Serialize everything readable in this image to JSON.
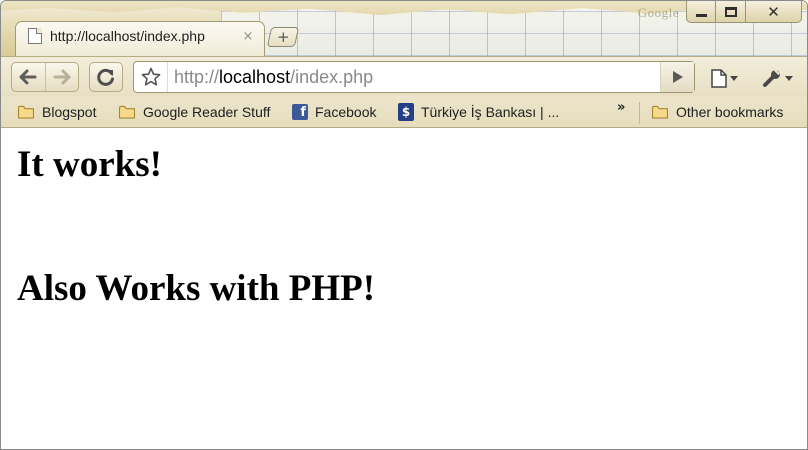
{
  "browser": {
    "tab": {
      "title": "http://localhost/index.php",
      "close_glyph": "×",
      "favicon": "page-icon"
    },
    "new_tab_glyph": "+",
    "window_controls": {
      "minimize": "minimize-icon",
      "maximize": "maximize-icon",
      "close": "close-icon",
      "close_glyph": "✕"
    },
    "toolbar": {
      "back": "back-arrow-icon",
      "forward": "forward-arrow-icon",
      "reload": "reload-icon",
      "star": "star-icon",
      "url_scheme": "http://",
      "url_host": "localhost",
      "url_path": "/index.php",
      "go": "play-icon",
      "page_menu": "page-icon",
      "wrench_menu": "wrench-icon"
    },
    "bookmarks": {
      "items": [
        {
          "label": "Blogspot",
          "icon": "folder-icon"
        },
        {
          "label": "Google Reader Stuff",
          "icon": "folder-icon"
        },
        {
          "label": "Facebook",
          "icon": "facebook-icon",
          "icon_glyph": "f"
        },
        {
          "label": "Türkiye İş Bankası | ...",
          "icon": "isbank-icon",
          "icon_glyph": "$"
        }
      ],
      "overflow_glyph": "»",
      "other_label": "Other bookmarks"
    },
    "theme_logo": "Google"
  },
  "page": {
    "heading_1": "It works!",
    "heading_2": "Also Works with PHP!"
  },
  "colors": {
    "frame": "#e8e0c4",
    "tab_active": "#f7f4e6",
    "page_background": "#ffffff",
    "text": "#000000",
    "facebook_blue": "#3b5998"
  }
}
